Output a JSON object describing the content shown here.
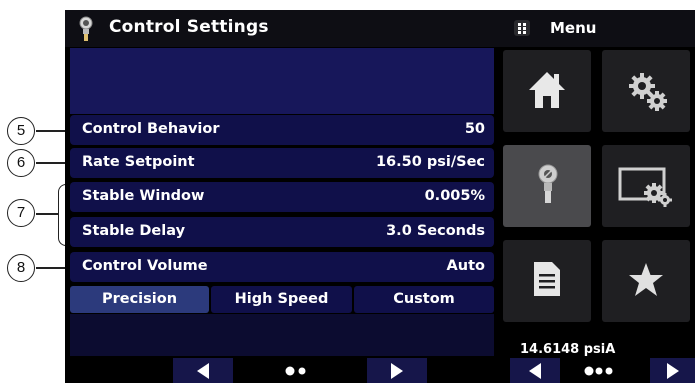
{
  "header": {
    "title": "Control Settings",
    "icon": "pressure-gauge-icon"
  },
  "settings": {
    "control_behavior": {
      "label": "Control Behavior",
      "value": "50"
    },
    "rate_setpoint": {
      "label": "Rate Setpoint",
      "value": "16.50 psi/Sec"
    },
    "stable_window": {
      "label": "Stable Window",
      "value": "0.005%"
    },
    "stable_delay": {
      "label": "Stable Delay",
      "value": "3.0 Seconds"
    },
    "control_volume": {
      "label": "Control Volume",
      "value": "Auto"
    }
  },
  "tabs": [
    {
      "label": "Precision",
      "selected": true
    },
    {
      "label": "High Speed",
      "selected": false
    },
    {
      "label": "Custom",
      "selected": false
    }
  ],
  "pager": {
    "left": "prev-arrow-icon",
    "right": "next-arrow-icon",
    "pages": 2,
    "current": 1
  },
  "menu": {
    "label": "Menu",
    "icon": "grid-icon",
    "tiles": [
      "home-icon",
      "gears-icon",
      "pressure-gauge-icon",
      "screen-settings-icon",
      "document-icon",
      "star-icon"
    ]
  },
  "status": {
    "pressure": "14.6148 psiA"
  },
  "callouts": [
    "5",
    "6",
    "7",
    "8"
  ],
  "colors": {
    "row_bg": "#10104a",
    "panel_bg": "#17175a",
    "tab_selected": "#2c3a7c",
    "tile_bg": "#1f1f22"
  }
}
